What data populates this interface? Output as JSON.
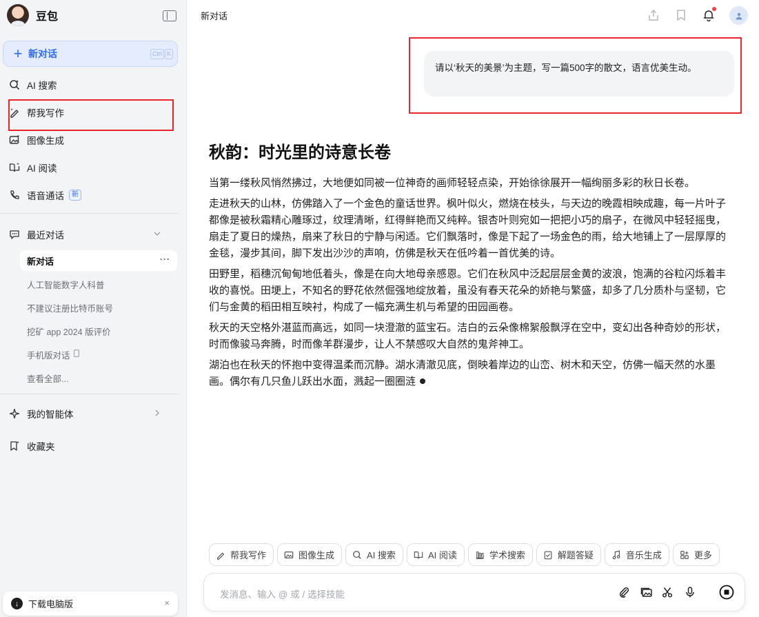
{
  "sidebar": {
    "brand": "豆包",
    "new_chat": {
      "label": "新对话",
      "shortcut": [
        "Ctrl",
        "K"
      ]
    },
    "nav": [
      {
        "label": "AI 搜索",
        "icon": "ai-search-icon"
      },
      {
        "label": "帮我写作",
        "icon": "pen-icon"
      },
      {
        "label": "图像生成",
        "icon": "image-icon"
      },
      {
        "label": "AI 阅读",
        "icon": "book-icon"
      },
      {
        "label": "语音通话",
        "icon": "phone-icon",
        "badge": "新"
      }
    ],
    "recent": {
      "title": "最近对话",
      "items": [
        "新对话",
        "人工智能数字人科普",
        "不建议注册比特币账号",
        "挖矿 app 2024 版评价",
        "手机版对话",
        "查看全部..."
      ],
      "active_more": "···"
    },
    "agents": "我的智能体",
    "favorites": "收藏夹",
    "download": "下载电脑版",
    "download_close": "×"
  },
  "main": {
    "title": "新对话",
    "user_message": "请以‘秋天的美景’为主题，写一篇500字的散文，语言优美生动。",
    "answer": {
      "title": "秋韵：时光里的诗意长卷",
      "paragraphs": [
        "当第一缕秋风悄然拂过，大地便如同被一位神奇的画师轻轻点染，开始徐徐展开一幅绚丽多彩的秋日长卷。",
        "走进秋天的山林，仿佛踏入了一个金色的童话世界。枫叶似火，燃烧在枝头，与天边的晚霞相映成趣，每一片叶子都像是被秋霜精心雕琢过，纹理清晰，红得鲜艳而又纯粹。银杏叶则宛如一把把小巧的扇子，在微风中轻轻摇曳，扇走了夏日的燥热，扇来了秋日的宁静与闲适。它们飘落时，像是下起了一场金色的雨，给大地铺上了一层厚厚的金毯，漫步其间，脚下发出沙沙的声响，仿佛是秋天在低吟着一首优美的诗。",
        "田野里，稻穗沉甸甸地低着头，像是在向大地母亲感恩。它们在秋风中泛起层层金黄的波浪，饱满的谷粒闪烁着丰收的喜悦。田埂上，不知名的野花依然倔强地绽放着，虽没有春天花朵的娇艳与繁盛，却多了几分质朴与坚韧，它们与金黄的稻田相互映衬，构成了一幅充满生机与希望的田园画卷。",
        "秋天的天空格外湛蓝而高远，如同一块澄澈的蓝宝石。洁白的云朵像棉絮般飘浮在空中，变幻出各种奇妙的形状，时而像骏马奔腾，时而像羊群漫步，让人不禁感叹大自然的鬼斧神工。",
        "湖泊也在秋天的怀抱中变得温柔而沉静。湖水清澈见底，倒映着岸边的山峦、树木和天空，仿佛一幅天然的水墨画。偶尔有几只鱼儿跃出水面，溅起一圈圈涟"
      ]
    },
    "skills": [
      "帮我写作",
      "图像生成",
      "AI 搜索",
      "AI 阅读",
      "学术搜索",
      "解题答疑",
      "音乐生成",
      "更多"
    ],
    "input_placeholder": "发消息、输入 @ 或 / 选择技能"
  },
  "colors": {
    "accent": "#2f6bf1",
    "highlight": "#e8262b"
  }
}
